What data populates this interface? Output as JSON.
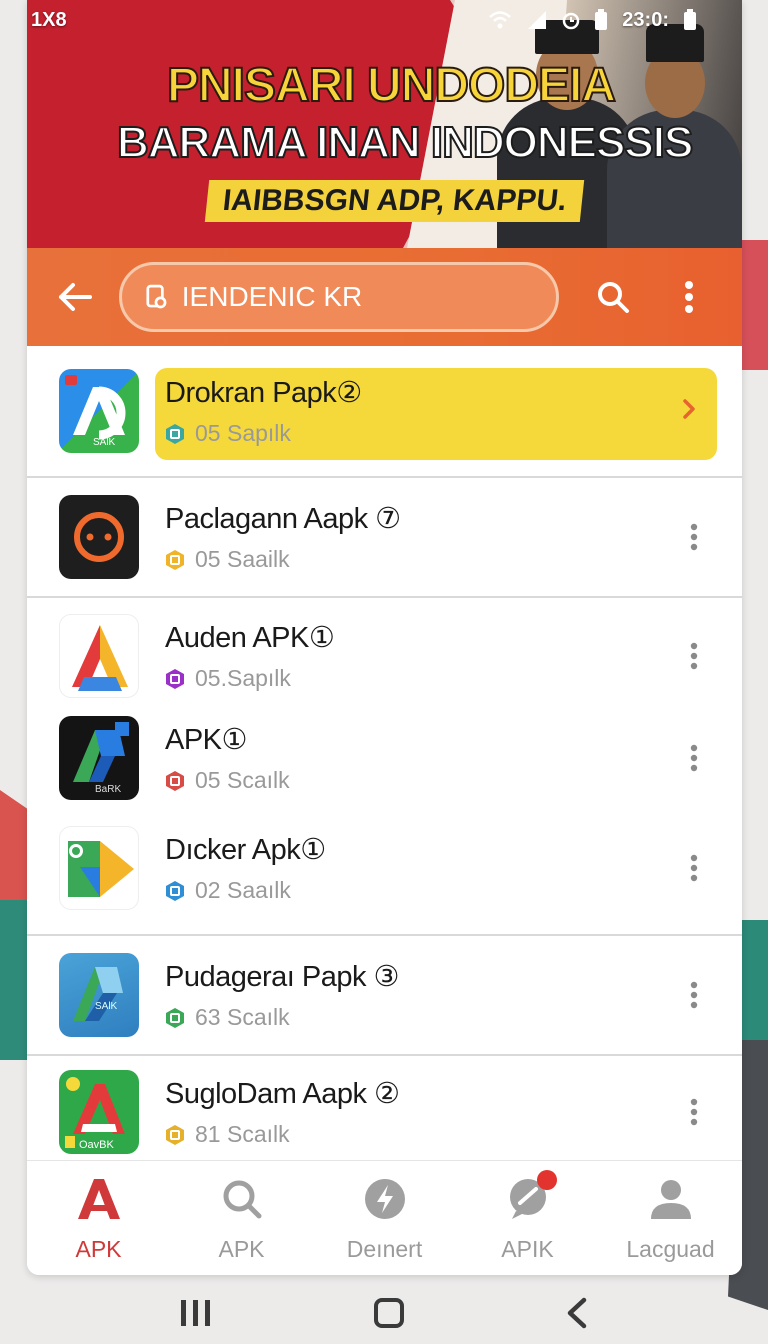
{
  "status_bar": {
    "time_left": "1X8",
    "time_right": "23:0:"
  },
  "banner": {
    "title_line1": "PNISARI UNDODEIA",
    "title_line2": "BARAMA INAN INDONESSIS",
    "tagline": "IAIBBSGN ADP, KAPPU."
  },
  "top_bar": {
    "search_value": "IENDENIC KR"
  },
  "apps": [
    {
      "name": "Drokran Papk②",
      "sub": "05 Sapılk",
      "hex_color": "#3aa8a0",
      "highlighted": true
    },
    {
      "name": "Paclagann Aapk ⑦",
      "sub": "05 Saailk",
      "hex_color": "#f0b429"
    },
    {
      "name": "Auden APK①",
      "sub": "05.Sapılk",
      "hex_color": "#9b30c8"
    },
    {
      "name": "APK①",
      "sub": "05 Scaılk",
      "hex_color": "#d94b45"
    },
    {
      "name": "Dıcker Apk①",
      "sub": "02 Saaılk",
      "hex_color": "#2e8fd6"
    },
    {
      "name": "Pudageraı Papk ③",
      "sub": "63 Scaılk",
      "hex_color": "#3aa856"
    },
    {
      "name": "SugloDam Aapk ②",
      "sub": "81 Scaılk",
      "hex_color": "#e6b02a"
    }
  ],
  "app_icon_labels": {
    "first": "SAlK",
    "fourth": "BaRK",
    "sixth": "SAlK",
    "seventh": "OavBK"
  },
  "bottom_nav": [
    {
      "label": "APK",
      "icon": "a-logo-icon"
    },
    {
      "label": "APK",
      "icon": "search-icon"
    },
    {
      "label": "Deınert",
      "icon": "lightning-icon"
    },
    {
      "label": "APIK",
      "icon": "chat-icon"
    },
    {
      "label": "Lacguad",
      "icon": "person-icon"
    }
  ],
  "colors": {
    "accent": "#e8703a",
    "highlight": "#f5d93b",
    "active": "#d0393a"
  }
}
